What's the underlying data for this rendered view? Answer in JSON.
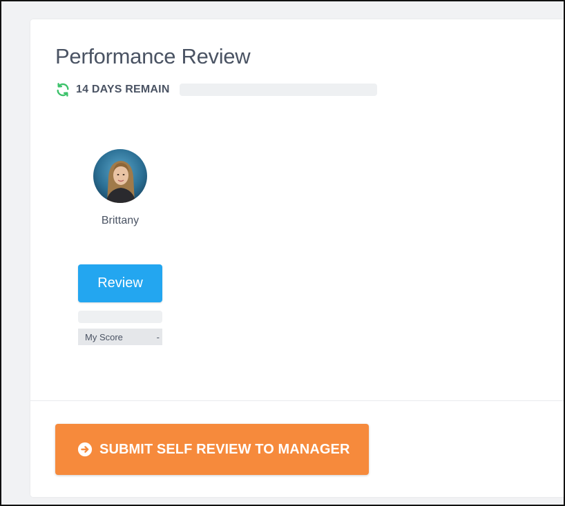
{
  "page": {
    "title": "Performance Review",
    "status": {
      "icon": "refresh-icon",
      "text": "14 DAYS REMAIN"
    }
  },
  "employee": {
    "name": "Brittany",
    "avatar": "avatar-photo",
    "review_button_label": "Review",
    "score_label": "My Score",
    "score_value": "-"
  },
  "footer": {
    "submit_button_label": "SUBMIT SELF REVIEW TO MANAGER",
    "submit_icon": "arrow-right-circle-icon"
  },
  "colors": {
    "accent_blue": "#23a6f0",
    "accent_orange": "#f68a3c",
    "status_green": "#3cc26a",
    "text": "#4a5363"
  }
}
